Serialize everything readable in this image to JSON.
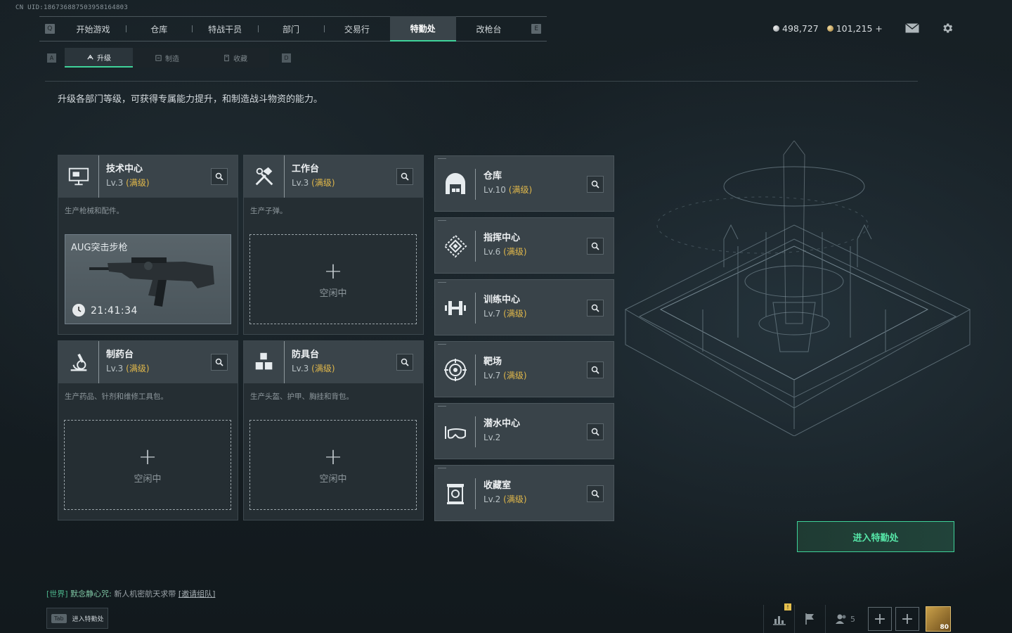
{
  "uid": "CN UID:18673688750395816480З",
  "nav": {
    "key_left": "Q",
    "key_right": "E",
    "tabs": [
      {
        "label": "开始游戏"
      },
      {
        "label": "仓库"
      },
      {
        "label": "特战干员"
      },
      {
        "label": "部门"
      },
      {
        "label": "交易行"
      },
      {
        "label": "特勤处"
      },
      {
        "label": "改枪台"
      }
    ],
    "active": "特勤处"
  },
  "currency": {
    "silver": "498,727",
    "gold": "101,215",
    "gold_add": "+"
  },
  "subnav": {
    "key_left": "A",
    "key_right": "D",
    "tabs": [
      {
        "label": "升级"
      },
      {
        "label": "制造"
      },
      {
        "label": "收藏"
      }
    ]
  },
  "description": "升级各部门等级，可获得专属能力提升，和制造战斗物资的能力。",
  "max_tag": "(满级)",
  "workshops": [
    {
      "name": "技术中心",
      "level": "Lv.3",
      "desc": "生产枪械和配件。",
      "crafting": {
        "item": "AUG突击步枪",
        "time": "21:41:34"
      }
    },
    {
      "name": "工作台",
      "level": "Lv.3",
      "desc": "生产子弹。",
      "idle": "空闲中"
    },
    {
      "name": "制药台",
      "level": "Lv.3",
      "desc": "生产药品、针剂和维修工具包。",
      "idle": "空闲中"
    },
    {
      "name": "防具台",
      "level": "Lv.3",
      "desc": "生产头盔、护甲、胸挂和背包。",
      "idle": "空闲中"
    }
  ],
  "facilities": [
    {
      "name": "仓库",
      "level": "Lv.10",
      "max": true,
      "icon": "warehouse-icon"
    },
    {
      "name": "指挥中心",
      "level": "Lv.6",
      "max": true,
      "icon": "command-icon"
    },
    {
      "name": "训练中心",
      "level": "Lv.7",
      "max": true,
      "icon": "dumbbell-icon"
    },
    {
      "name": "靶场",
      "level": "Lv.7",
      "max": true,
      "icon": "target-icon"
    },
    {
      "name": "潜水中心",
      "level": "Lv.2",
      "max": false,
      "icon": "diving-mask-icon"
    },
    {
      "name": "收藏室",
      "level": "Lv.2",
      "max": true,
      "icon": "trophy-icon"
    }
  ],
  "enter_button": "进入特勤处",
  "chat": {
    "channel": "[世界]",
    "sender": "默念静心咒:",
    "message": "新人机密航天求带",
    "link": "[邀请组队]"
  },
  "tab_hint": {
    "key": "Tab",
    "label": "进入特勤处"
  },
  "bottom": {
    "stats_badge": "!",
    "friends_count": "5",
    "player_level": "80"
  },
  "colors": {
    "accent": "#3fd39a",
    "max_level": "#e1b84a",
    "panel": "#3a444a"
  }
}
